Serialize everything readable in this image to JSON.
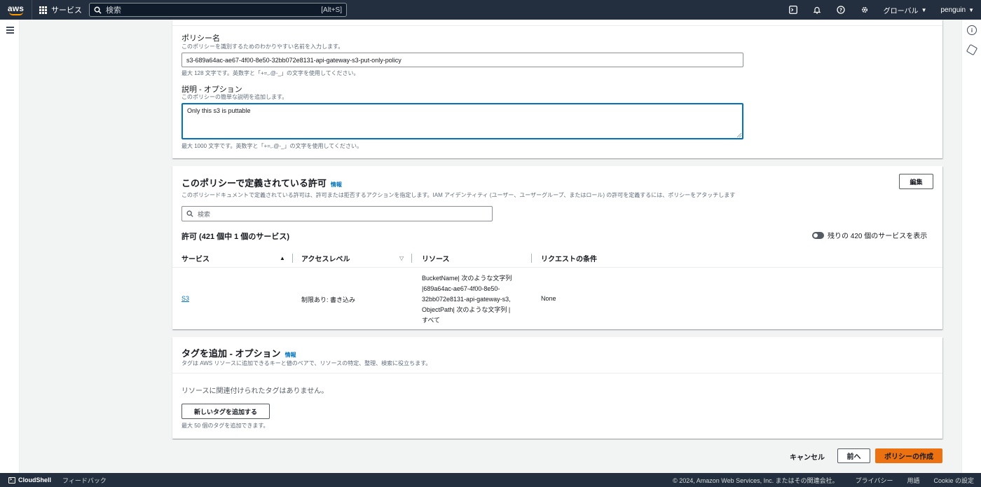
{
  "nav": {
    "logo": "aws",
    "services": "サービス",
    "search_placeholder": "検索",
    "search_shortcut": "[Alt+S]",
    "region": "グローバル",
    "user": "penguin"
  },
  "policy_details": {
    "name_label": "ポリシー名",
    "name_desc": "このポリシーを識別するためのわかりやすい名前を入力します。",
    "name_value": "s3-689a64ac-ae67-4f00-8e50-32bb072e8131-api-gateway-s3-put-only-policy",
    "name_hint": "最大 128 文字です。英数字と「+=,.@-_」の文字を使用してください。",
    "desc_label": "説明 - オプション",
    "desc_desc": "このポリシーの簡単な説明を追加します。",
    "desc_value": "Only this s3 is puttable",
    "desc_hint": "最大 1000 文字です。英数字と「+=,.@-_」の文字を使用してください。"
  },
  "permissions": {
    "title": "このポリシーで定義されている許可",
    "info": "情報",
    "description": "このポリシードキュメントで定義されている許可は、許可または拒否するアクションを指定します。IAM アイデンティティ (ユーザー、ユーザーグループ、またはロール) の許可を定義するには、ポリシーをアタッチします",
    "edit_button": "編集",
    "search_placeholder": "検索",
    "count_label": "許可 (421 個中 1 個のサービス)",
    "toggle_label": "残りの 420 個のサービスを表示",
    "columns": [
      "サービス",
      "アクセスレベル",
      "リソース",
      "リクエストの条件"
    ],
    "rows": [
      {
        "service": "S3",
        "access": "制限あり: 書き込み",
        "resource_lines": [
          "BucketName| 次のような文字列",
          "|689a64ac-ae67-4f00-8e50-",
          "32bb072e8131-api-gateway-s3,",
          "ObjectPath| 次のような文字列 |",
          "すべて"
        ],
        "condition": "None"
      }
    ]
  },
  "tags": {
    "title": "タグを追加 - オプション",
    "info": "情報",
    "description": "タグは AWS リソースに追加できるキーと値のペアで、リソースの特定、整理、検索に役立ちます。",
    "empty": "リソースに関連付けられたタグはありません。",
    "add_button": "新しいタグを追加する",
    "hint": "最大 50 個のタグを追加できます。"
  },
  "actions": {
    "cancel": "キャンセル",
    "previous": "前へ",
    "create": "ポリシーの作成"
  },
  "footer": {
    "cloudshell": "CloudShell",
    "feedback": "フィードバック",
    "copyright": "© 2024, Amazon Web Services, Inc. またはその関連会社。",
    "privacy": "プライバシー",
    "terms": "用語",
    "cookie": "Cookie の設定"
  },
  "colors": {
    "nav_bg": "#232f3e",
    "primary": "#ec7211",
    "link": "#0073bb",
    "focus": "#0073bb"
  }
}
